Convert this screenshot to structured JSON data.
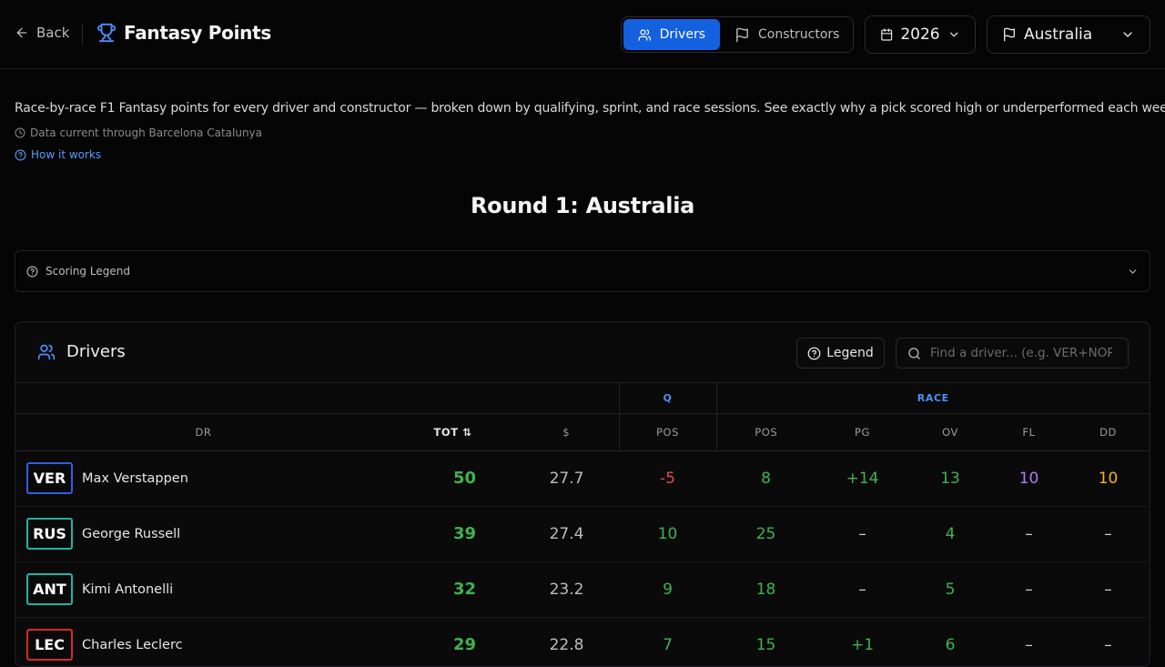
{
  "header": {
    "back_label": "Back",
    "title": "Fantasy Points",
    "tabs": [
      {
        "label": "Drivers",
        "active": true
      },
      {
        "label": "Constructors",
        "active": false
      }
    ],
    "season": "2026",
    "race": "Australia"
  },
  "intro": {
    "description": "Race-by-race F1 Fantasy points for every driver and constructor — broken down by qualifying, sprint, and race sessions. See exactly why a pick scored high or underperformed each weekend.",
    "data_current": "Data current through Barcelona Catalunya",
    "how_it_works": "How it works"
  },
  "round_title": "Round 1: Australia",
  "scoring_legend": "Scoring Legend",
  "drivers_panel": {
    "title": "Drivers",
    "legend_label": "Legend",
    "search_placeholder": "Find a driver... (e.g. VER+NOR)",
    "groups": {
      "q": "Q",
      "race": "RACE"
    },
    "columns": {
      "dr": "DR",
      "tot": "TOT ⇅",
      "price": "$",
      "q_pos": "POS",
      "race_pos": "POS",
      "pg": "PG",
      "ov": "OV",
      "fl": "FL",
      "dd": "DD"
    },
    "rows": [
      {
        "code": "VER",
        "name": "Max Verstappen",
        "badge_color": "#2f5fe0",
        "tot": "50",
        "price": "27.7",
        "q_pos": "-5",
        "race_pos": "8",
        "pg": "+14",
        "ov": "13",
        "fl": "10",
        "dd": "10"
      },
      {
        "code": "RUS",
        "name": "George Russell",
        "badge_color": "#22b3a3",
        "tot": "39",
        "price": "27.4",
        "q_pos": "10",
        "race_pos": "25",
        "pg": "–",
        "ov": "4",
        "fl": "–",
        "dd": "–"
      },
      {
        "code": "ANT",
        "name": "Kimi Antonelli",
        "badge_color": "#22b3a3",
        "tot": "32",
        "price": "23.2",
        "q_pos": "9",
        "race_pos": "18",
        "pg": "–",
        "ov": "5",
        "fl": "–",
        "dd": "–"
      },
      {
        "code": "LEC",
        "name": "Charles Leclerc",
        "badge_color": "#d42a2a",
        "tot": "29",
        "price": "22.8",
        "q_pos": "7",
        "race_pos": "15",
        "pg": "+1",
        "ov": "6",
        "fl": "–",
        "dd": "–"
      }
    ]
  }
}
